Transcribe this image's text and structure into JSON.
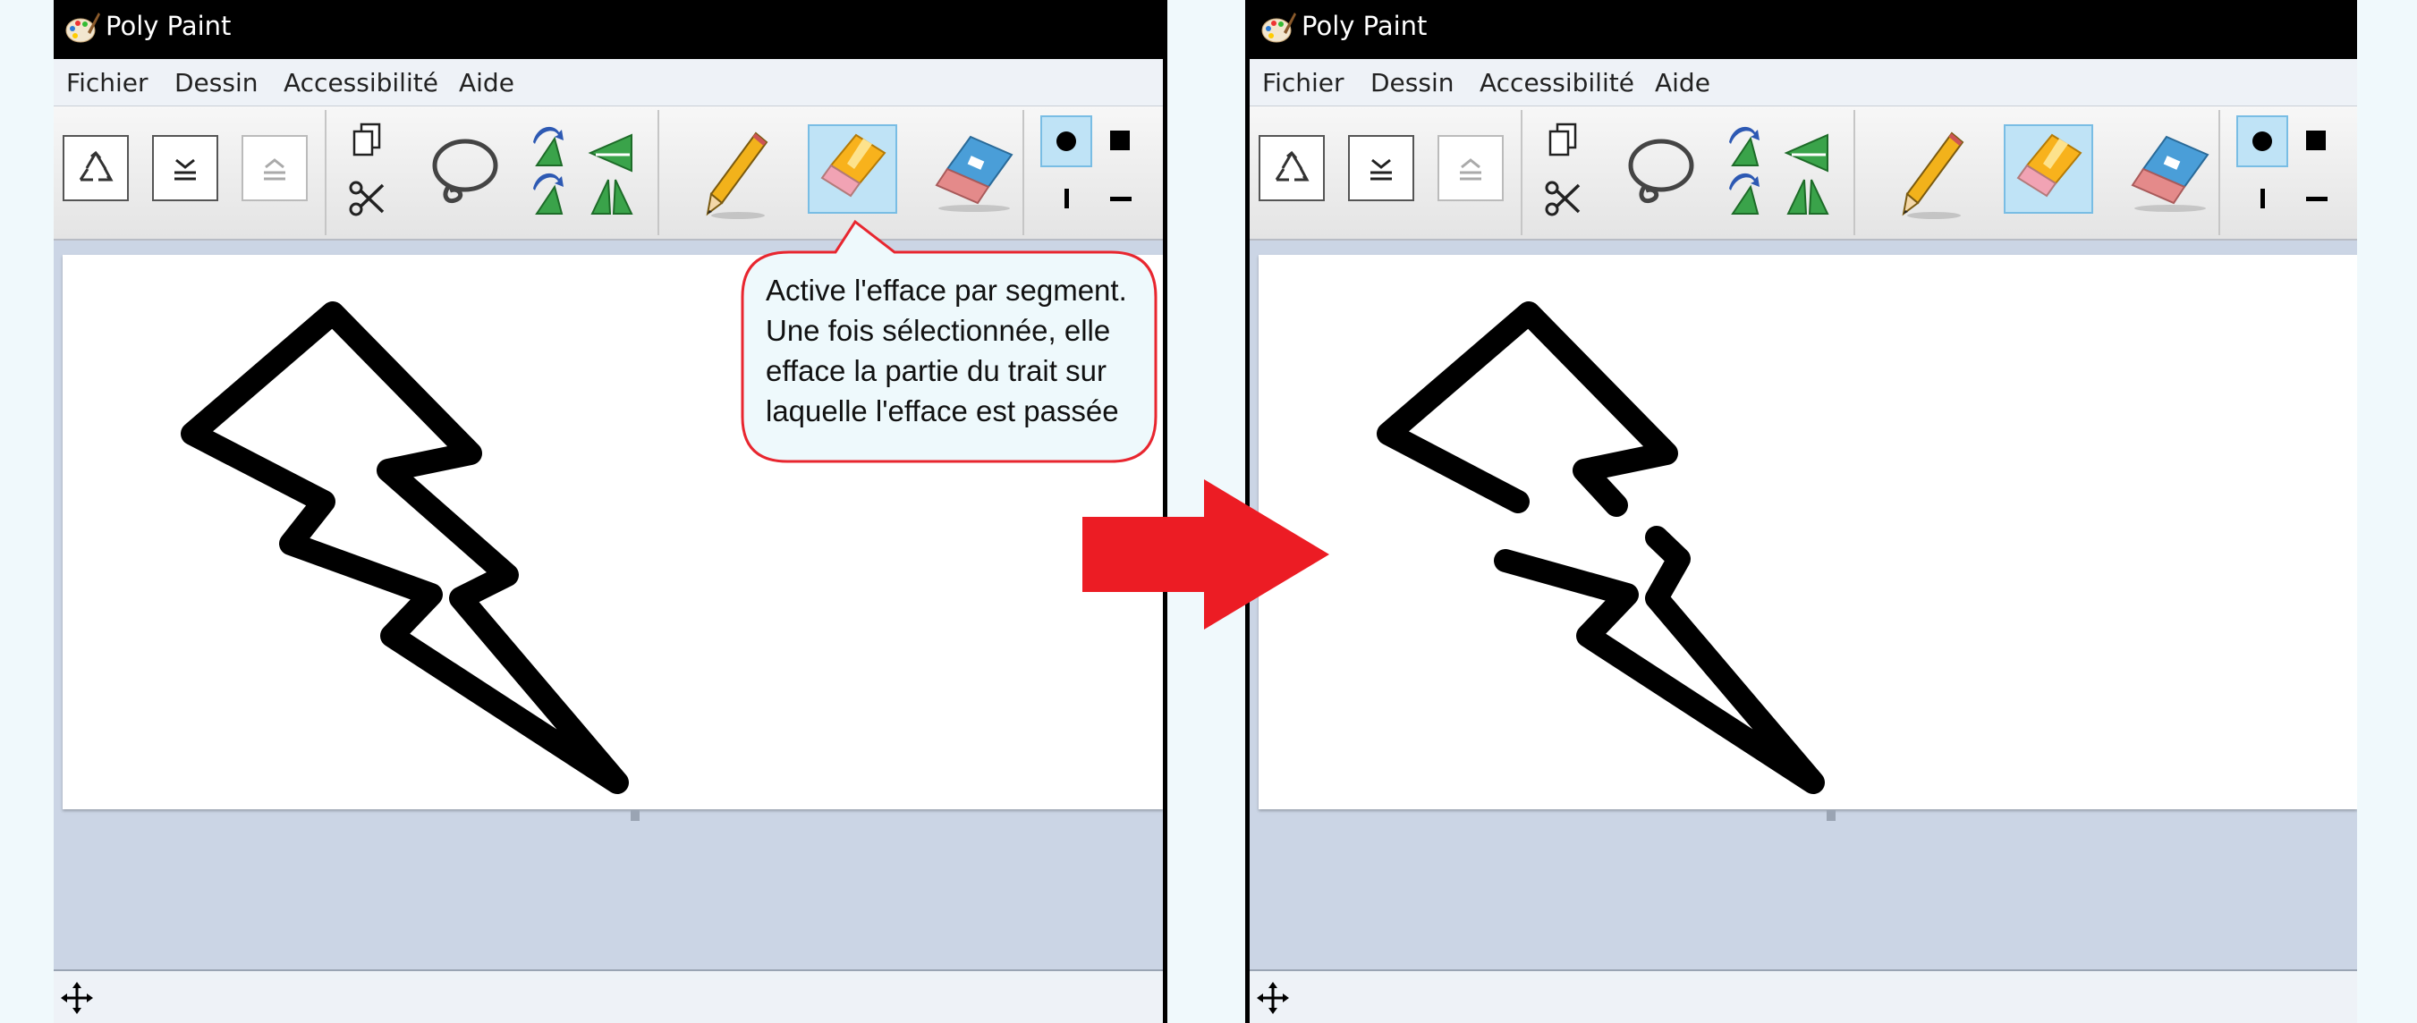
{
  "app": {
    "title": "Poly Paint"
  },
  "menu": {
    "items": [
      "Fichier",
      "Dessin",
      "Accessibilité",
      "Aide"
    ]
  },
  "tooltip": {
    "lines": [
      "Active l'efface par segment.",
      "Une fois sélectionnée, elle",
      "efface la partie du trait sur",
      "laquelle l'efface est passée"
    ]
  },
  "colors": {
    "titlebar": "#000000",
    "arrow": "#ec1c24",
    "tooltip_border": "#e8262f",
    "tooltip_fill": "#eef9fc",
    "selected_tool": "#bfe3f6",
    "workspace": "#cbd5e5"
  },
  "toolbar_icons": [
    "recycle-icon",
    "align-bottom-icon",
    "align-top-icon",
    "copy-icon",
    "scissors-icon",
    "lasso-icon",
    "rotate-icon",
    "flip-icon",
    "pencil-icon",
    "segment-eraser-icon",
    "stroke-eraser-icon",
    "round-tip-icon",
    "square-tip-icon",
    "vertical-tip-icon",
    "horizontal-tip-icon"
  ],
  "active_tool": "segment-eraser"
}
